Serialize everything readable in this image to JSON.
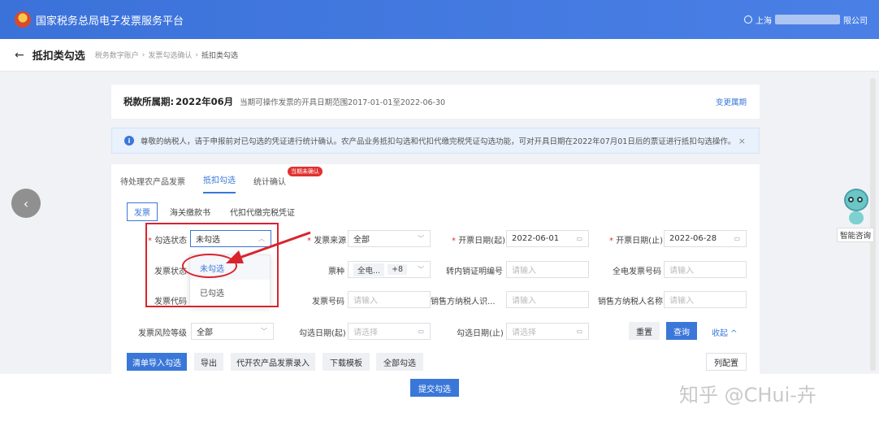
{
  "header": {
    "title": "国家税务总局电子发票服务平台",
    "user_prefix": "上海",
    "user_suffix": "限公司"
  },
  "breadcrumb": {
    "page_title": "抵扣类勾选",
    "items": [
      "税务数字账户",
      "发票勾选确认",
      "抵扣类勾选"
    ]
  },
  "period": {
    "label": "税款所属期:",
    "value": "2022年06月",
    "range_text": "当期可操作发票的开具日期范围2017-01-01至2022-06-30",
    "change_label": "变更属期"
  },
  "notice": {
    "text": "尊敬的纳税人，请于申报前对已勾选的凭证进行统计确认。农产品业务抵扣勾选和代扣代缴完税凭证勾选功能，可对开具日期在2022年07月01日后的票证进行抵扣勾选操作。",
    "close": "×"
  },
  "tabs": [
    {
      "label": "待处理农产品发票"
    },
    {
      "label": "抵扣勾选"
    },
    {
      "label": "统计确认",
      "badge": "当期未确认"
    }
  ],
  "subtabs": [
    "发票",
    "海关缴款书",
    "代扣代缴完税凭证"
  ],
  "filters": {
    "check_status": {
      "label": "勾选状态",
      "value": "未勾选"
    },
    "invoice_source": {
      "label": "发票来源",
      "value": "全部"
    },
    "issue_date_start": {
      "label": "开票日期(起)",
      "value": "2022-06-01"
    },
    "issue_date_end": {
      "label": "开票日期(止)",
      "value": "2022-06-28"
    },
    "invoice_status": {
      "label": "发票状态"
    },
    "invoice_type": {
      "label": "票种",
      "tag": "全电...",
      "more": "+8"
    },
    "transfer_no": {
      "label": "转内销证明编号",
      "placeholder": "请输入"
    },
    "all_elec_no": {
      "label": "全电发票号码",
      "placeholder": "请输入"
    },
    "invoice_code": {
      "label": "发票代码"
    },
    "invoice_no": {
      "label": "发票号码",
      "placeholder": "请输入"
    },
    "seller_tax_id": {
      "label": "销售方纳税人识...",
      "placeholder": "请输入"
    },
    "seller_name": {
      "label": "销售方纳税人名称",
      "placeholder": "请输入"
    },
    "risk_level": {
      "label": "发票风险等级",
      "value": "全部"
    },
    "check_date_start": {
      "label": "勾选日期(起)",
      "placeholder": "请选择"
    },
    "check_date_end": {
      "label": "勾选日期(止)",
      "placeholder": "请选择"
    }
  },
  "dropdown_options": [
    "未勾选",
    "已勾选"
  ],
  "actions": {
    "reset": "重置",
    "query": "查询",
    "collapse": "收起 ^"
  },
  "toolbar": [
    "清单导入勾选",
    "导出",
    "代开农产品发票录入",
    "下载模板",
    "全部勾选"
  ],
  "column_config": "列配置",
  "submit": "提交勾选",
  "assistant": {
    "label": "智能咨询"
  },
  "watermark": "知乎 @CHui-卉"
}
